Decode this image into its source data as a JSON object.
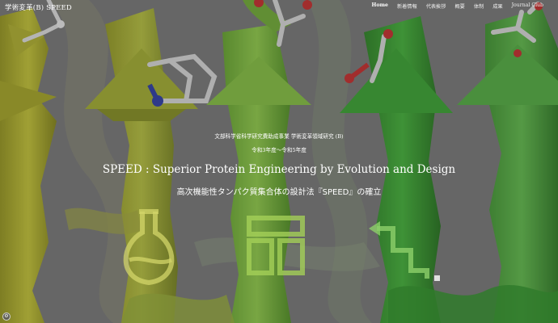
{
  "header": {
    "site_title": "学術変革(B) SPEED",
    "nav": [
      {
        "label": "Home",
        "active": true
      },
      {
        "label": "新着情報",
        "active": false
      },
      {
        "label": "代表挨拶",
        "active": false
      },
      {
        "label": "概要",
        "active": false
      },
      {
        "label": "体制",
        "active": false
      },
      {
        "label": "成果",
        "active": false
      },
      {
        "label": "Journal Club",
        "active": false
      }
    ]
  },
  "hero": {
    "funding": "文部科学省科学研究費助成事業 学術変革領域研究 (B)",
    "period": "令和3年度〜令和5年度",
    "title_en": "SPEED : Superior Protein Engineering by Evolution and Design",
    "title_ja": "高次機能性タンパク質集合体の設計法『SPEED』の確立"
  },
  "icons": [
    "flask-icon",
    "building-block-icon",
    "arrow-path-icon",
    "settings-icon"
  ],
  "colors": {
    "yellow_ribbon": "#a7a72a",
    "green_ribbon": "#6fa838",
    "dark_green_ribbon": "#2f8f2a",
    "background": "#6b6b6b",
    "text": "#ffffff"
  }
}
